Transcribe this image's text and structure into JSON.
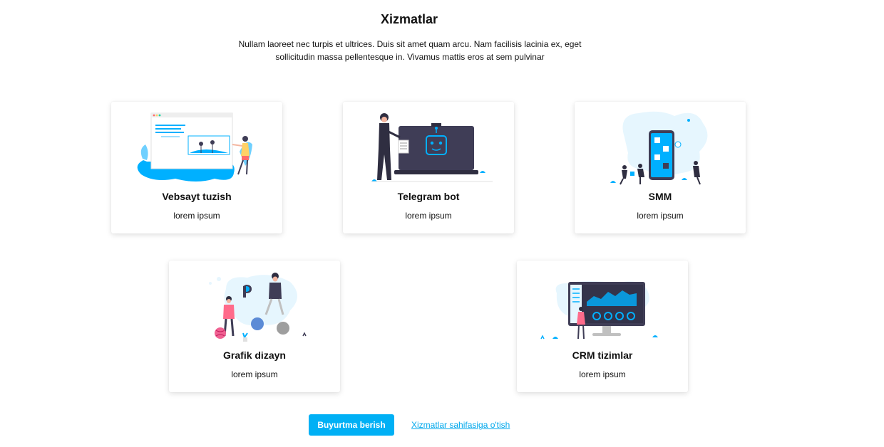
{
  "section": {
    "title": "Xizmatlar",
    "description": "Nullam laoreet nec turpis et ultrices. Duis sit amet quam arcu. Nam facilisis lacinia ex, eget sollicitudin massa pellentesque in. Vivamus mattis eros at sem pulvinar"
  },
  "services": [
    {
      "title": "Vebsayt tuzish",
      "subtitle": "lorem ipsum",
      "illustration": "website-builder-illustration"
    },
    {
      "title": "Telegram bot",
      "subtitle": "lorem ipsum",
      "illustration": "telegram-bot-illustration"
    },
    {
      "title": "SMM",
      "subtitle": "lorem ipsum",
      "illustration": "smm-illustration"
    },
    {
      "title": "Grafik dizayn",
      "subtitle": "lorem ipsum",
      "illustration": "graphic-design-illustration"
    },
    {
      "title": "CRM tizimlar",
      "subtitle": "lorem ipsum",
      "illustration": "crm-illustration"
    }
  ],
  "actions": {
    "order_button": "Buyurtma berish",
    "services_link": "Xizmatlar sahifasiga o'tish"
  },
  "colors": {
    "accent": "#00b0f5",
    "illustration_blue": "#00b0ff",
    "illustration_dark": "#3f3d56",
    "illustration_light": "#e6f6fe"
  }
}
